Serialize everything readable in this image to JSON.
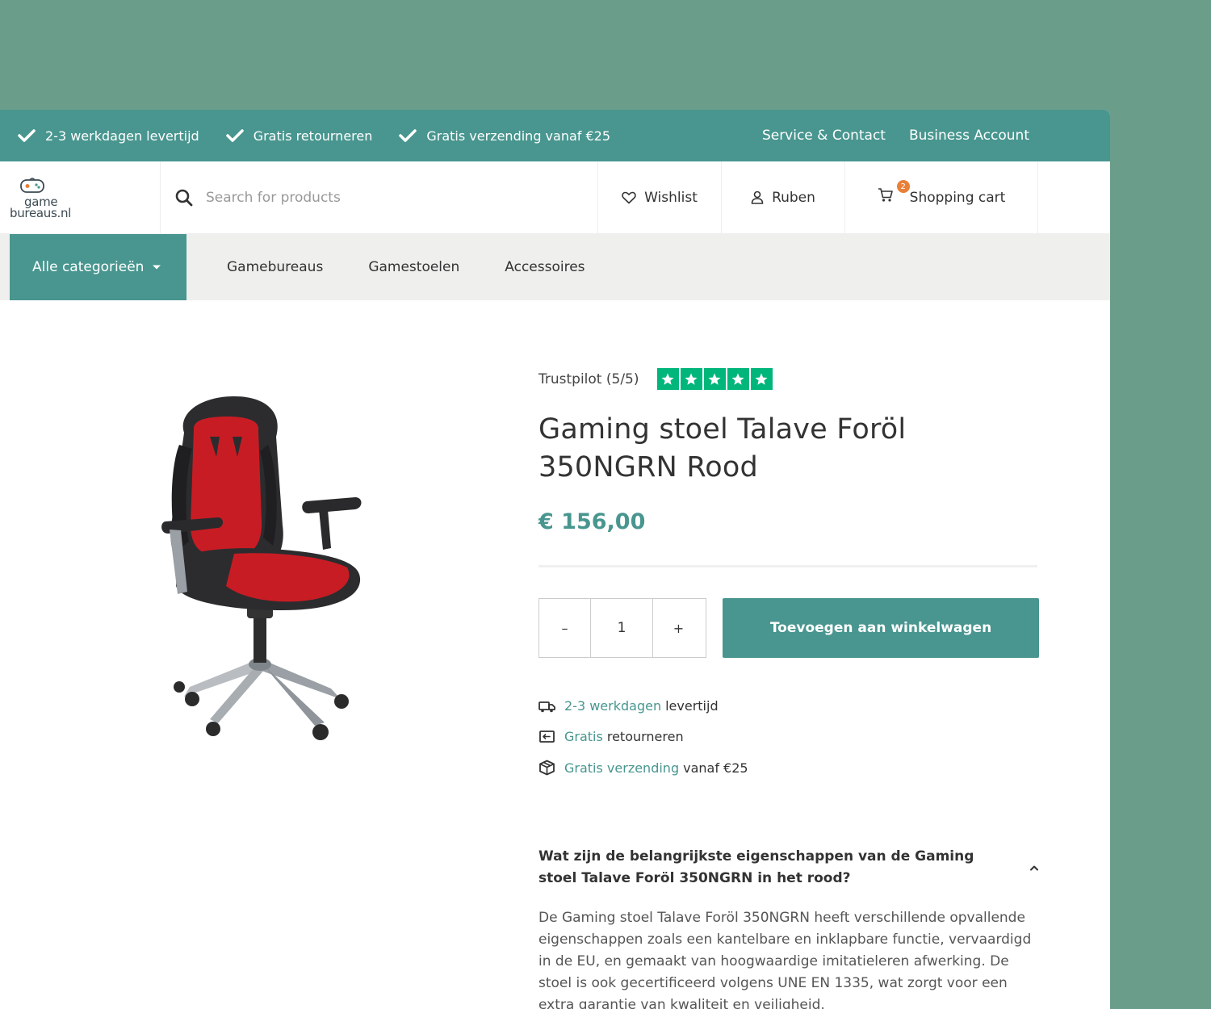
{
  "topbar": {
    "usps": [
      "2-3 werkdagen levertijd",
      "Gratis retourneren",
      "Gratis verzending vanaf €25"
    ],
    "links": [
      "Service & Contact",
      "Business Account"
    ]
  },
  "header": {
    "logo_line1": "game",
    "logo_line2": "bureaus.nl",
    "search_placeholder": "Search for products",
    "wishlist": "Wishlist",
    "user": "Ruben",
    "cart": "Shopping cart",
    "cart_count": "2"
  },
  "nav": {
    "all_label": "Alle categorieën",
    "items": [
      "Gamebureaus",
      "Gamestoelen",
      "Accessoires"
    ]
  },
  "product": {
    "trustpilot": "Trustpilot (5/5)",
    "rating_stars": 5,
    "title": "Gaming stoel Talave Foröl 350NGRN Rood",
    "price": "€ 156,00",
    "quantity": "1",
    "minus": "–",
    "plus": "+",
    "add_to_cart": "Toevoegen aan winkelwagen",
    "usps": [
      {
        "highlight": "2-3 werkdagen",
        "rest": "levertijd"
      },
      {
        "highlight": "Gratis",
        "rest": "retourneren"
      },
      {
        "highlight": "Gratis verzending",
        "rest": "vanaf €25"
      }
    ]
  },
  "faq": {
    "question": "Wat zijn de belangrijkste eigenschappen van de Gaming stoel Talave Foröl 350NGRN in het rood?",
    "answer": "De Gaming stoel Talave Foröl 350NGRN heeft verschillende opvallende eigenschappen zoals een kantelbare en inklapbare functie, vervaardigd in de EU, en gemaakt van hoogwaardige imitatieleren afwerking. De stoel is ook gecertificeerd volgens UNE EN 1335, wat zorgt voor een extra garantie van kwaliteit en veiligheid."
  },
  "colors": {
    "accent": "#48968f",
    "background": "#6a9e8a",
    "trustpilot_green": "#00b67a",
    "badge": "#e8803a"
  }
}
